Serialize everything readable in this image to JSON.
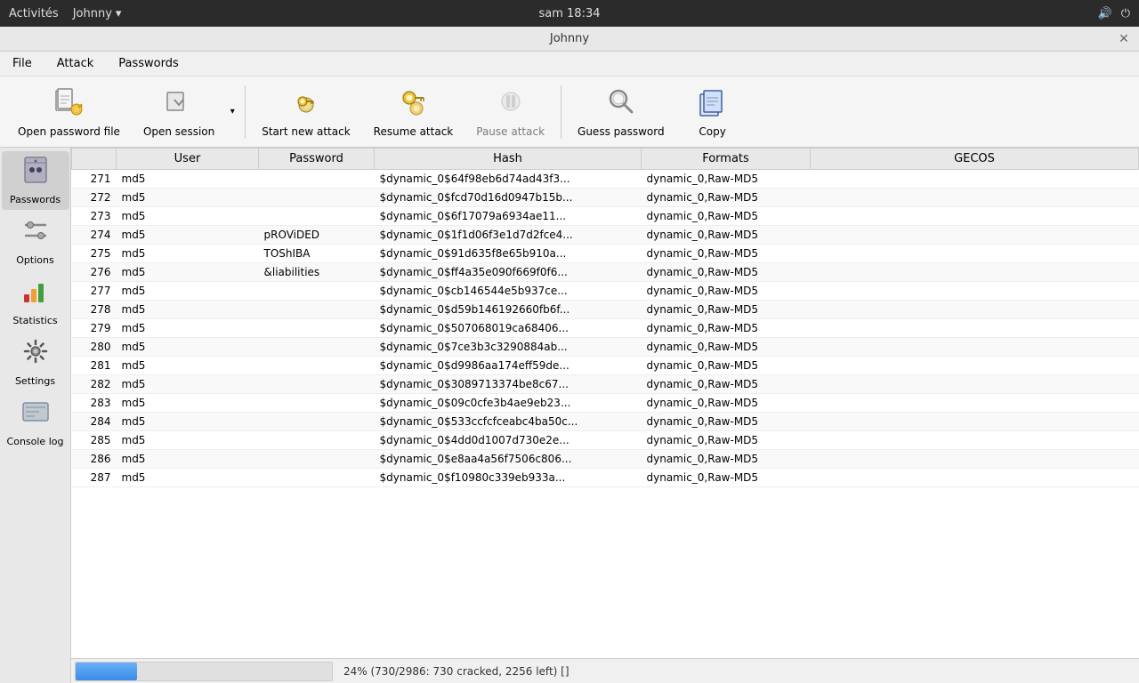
{
  "topbar": {
    "activities": "Activités",
    "app": "Johnny",
    "app_arrow": "▾",
    "time": "sam 18:34",
    "volume_icon": "🔊",
    "power_icon": "⏻"
  },
  "window": {
    "title": "Johnny",
    "close": "✕"
  },
  "menubar": {
    "items": [
      "File",
      "Attack",
      "Passwords"
    ]
  },
  "toolbar": {
    "open_password_file": "Open password file",
    "open_session": "Open session",
    "start_new_attack": "Start new attack",
    "resume_attack": "Resume attack",
    "pause_attack": "Pause attack",
    "guess_password": "Guess password",
    "copy": "Copy"
  },
  "sidebar": {
    "passwords_label": "Passwords",
    "options_label": "Options",
    "statistics_label": "Statistics",
    "settings_label": "Settings",
    "console_log_label": "Console log"
  },
  "table": {
    "columns": [
      "User",
      "Password",
      "Hash",
      "Formats",
      "GECOS"
    ],
    "rows": [
      {
        "num": "271",
        "user": "md5",
        "password": "",
        "hash": "$dynamic_0$64f98eb6d74ad43f3...",
        "formats": "dynamic_0,Raw-MD5",
        "gecos": ""
      },
      {
        "num": "272",
        "user": "md5",
        "password": "",
        "hash": "$dynamic_0$fcd70d16d0947b15b...",
        "formats": "dynamic_0,Raw-MD5",
        "gecos": ""
      },
      {
        "num": "273",
        "user": "md5",
        "password": "",
        "hash": "$dynamic_0$6f17079a6934ae11...",
        "formats": "dynamic_0,Raw-MD5",
        "gecos": ""
      },
      {
        "num": "274",
        "user": "md5",
        "password": "pROViDED",
        "hash": "$dynamic_0$1f1d06f3e1d7d2fce4...",
        "formats": "dynamic_0,Raw-MD5",
        "gecos": ""
      },
      {
        "num": "275",
        "user": "md5",
        "password": "TOShIBA",
        "hash": "$dynamic_0$91d635f8e65b910a...",
        "formats": "dynamic_0,Raw-MD5",
        "gecos": ""
      },
      {
        "num": "276",
        "user": "md5",
        "password": "&liabilities",
        "hash": "$dynamic_0$ff4a35e090f669f0f6...",
        "formats": "dynamic_0,Raw-MD5",
        "gecos": ""
      },
      {
        "num": "277",
        "user": "md5",
        "password": "",
        "hash": "$dynamic_0$cb146544e5b937ce...",
        "formats": "dynamic_0,Raw-MD5",
        "gecos": ""
      },
      {
        "num": "278",
        "user": "md5",
        "password": "",
        "hash": "$dynamic_0$d59b146192660fb6f...",
        "formats": "dynamic_0,Raw-MD5",
        "gecos": ""
      },
      {
        "num": "279",
        "user": "md5",
        "password": "",
        "hash": "$dynamic_0$507068019ca68406...",
        "formats": "dynamic_0,Raw-MD5",
        "gecos": ""
      },
      {
        "num": "280",
        "user": "md5",
        "password": "",
        "hash": "$dynamic_0$7ce3b3c3290884ab...",
        "formats": "dynamic_0,Raw-MD5",
        "gecos": ""
      },
      {
        "num": "281",
        "user": "md5",
        "password": "",
        "hash": "$dynamic_0$d9986aa174eff59de...",
        "formats": "dynamic_0,Raw-MD5",
        "gecos": ""
      },
      {
        "num": "282",
        "user": "md5",
        "password": "",
        "hash": "$dynamic_0$3089713374be8c67...",
        "formats": "dynamic_0,Raw-MD5",
        "gecos": ""
      },
      {
        "num": "283",
        "user": "md5",
        "password": "",
        "hash": "$dynamic_0$09c0cfe3b4ae9eb23...",
        "formats": "dynamic_0,Raw-MD5",
        "gecos": ""
      },
      {
        "num": "284",
        "user": "md5",
        "password": "",
        "hash": "$dynamic_0$533ccfcfceabc4ba50c...",
        "formats": "dynamic_0,Raw-MD5",
        "gecos": ""
      },
      {
        "num": "285",
        "user": "md5",
        "password": "",
        "hash": "$dynamic_0$4dd0d1007d730e2e...",
        "formats": "dynamic_0,Raw-MD5",
        "gecos": ""
      },
      {
        "num": "286",
        "user": "md5",
        "password": "",
        "hash": "$dynamic_0$e8aa4a56f7506c806...",
        "formats": "dynamic_0,Raw-MD5",
        "gecos": ""
      },
      {
        "num": "287",
        "user": "md5",
        "password": "",
        "hash": "$dynamic_0$f10980c339eb933a...",
        "formats": "dynamic_0,Raw-MD5",
        "gecos": ""
      }
    ]
  },
  "statusbar": {
    "progress_percent": 24,
    "status_text": "24% (730/2986: 730 cracked, 2256 left) []"
  }
}
